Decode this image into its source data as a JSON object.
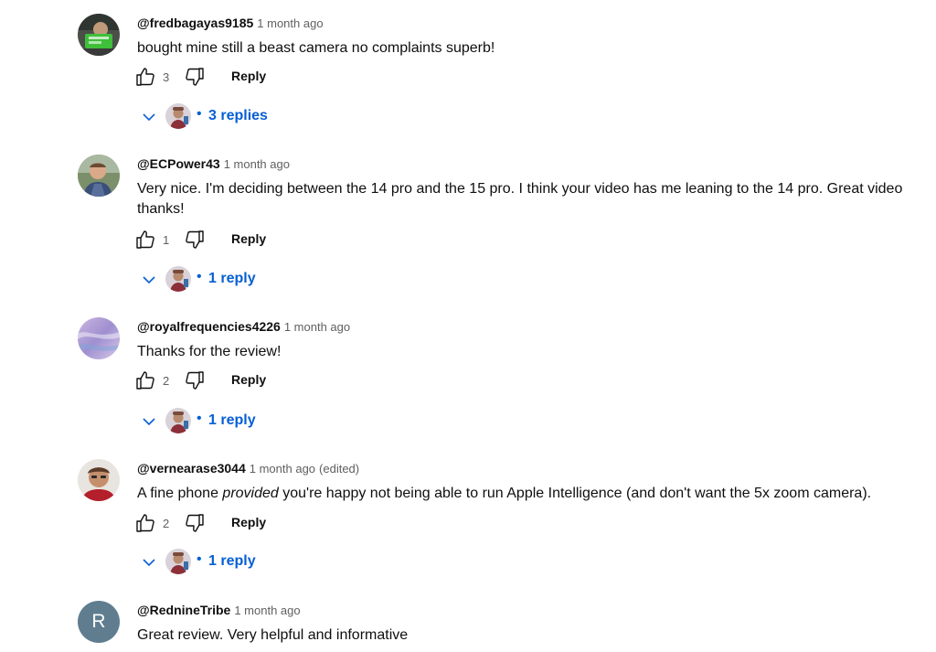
{
  "comments": [
    {
      "author": "@fredbagayas9185",
      "time": "1 month ago",
      "text": "bought mine still a beast camera no complaints superb!",
      "likes": "3",
      "reply_label": "Reply",
      "replies_label": "3 replies",
      "avatar": "green-card-photo"
    },
    {
      "author": "@ECPower43",
      "time": "1 month ago",
      "text": "Very nice. I'm deciding between the 14 pro and the 15 pro. I think your video has me leaning to the 14 pro. Great video thanks!",
      "likes": "1",
      "reply_label": "Reply",
      "replies_label": "1 reply",
      "avatar": "man-portrait-photo"
    },
    {
      "author": "@royalfrequencies4226",
      "time": "1 month ago",
      "text": "Thanks for the review!",
      "likes": "2",
      "reply_label": "Reply",
      "replies_label": "1 reply",
      "avatar": "purple-abstract-photo"
    },
    {
      "author": "@vernearase3044",
      "time": "1 month ago",
      "edited": "(edited)",
      "text_before": "A fine phone ",
      "text_emphasis": "provided",
      "text_after": " you're happy not being able to run Apple Intelligence (and don't want the 5x zoom camera).",
      "likes": "2",
      "reply_label": "Reply",
      "replies_label": "1 reply",
      "avatar": "older-man-photo"
    },
    {
      "author": "@RednineTribe",
      "time": "1 month ago",
      "text": "Great review. Very helpful and informative",
      "avatar_letter": "R",
      "avatar_color": "#5f7d8f"
    }
  ],
  "icons": {
    "like": "thumbs-up-icon",
    "dislike": "thumbs-down-icon",
    "expand": "chevron-down-icon"
  },
  "colors": {
    "link_blue": "#065fd4",
    "secondary_text": "#606060"
  }
}
